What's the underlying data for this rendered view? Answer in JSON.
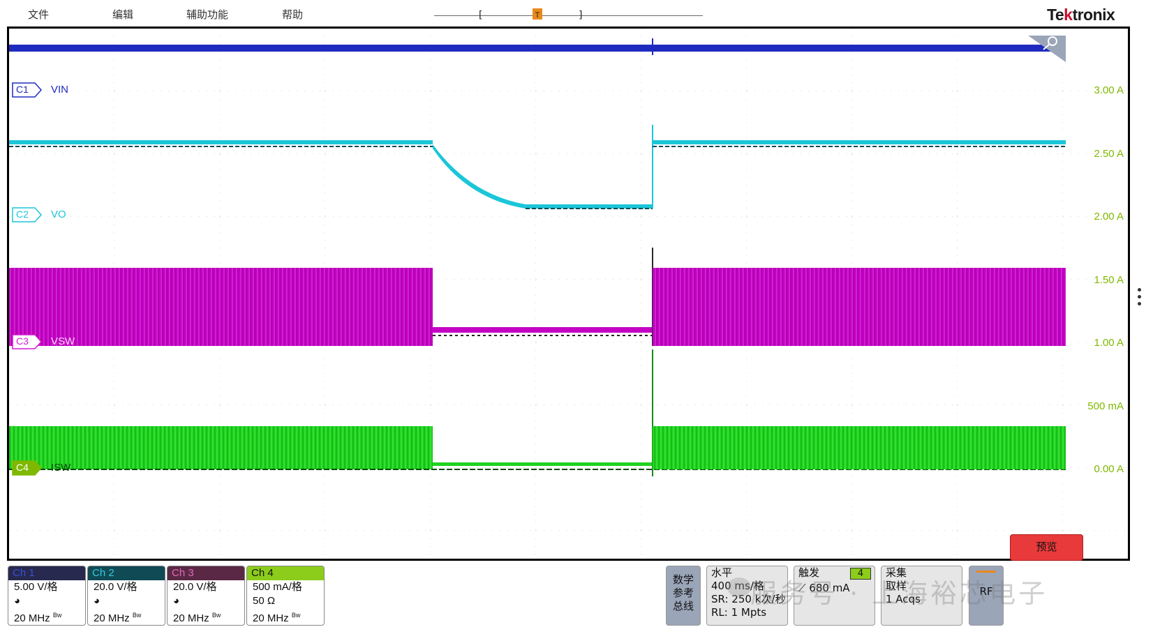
{
  "menu": [
    "文件",
    "编辑",
    "辅助功能",
    "帮助"
  ],
  "brand": {
    "prefix": "Te",
    "mark": "k",
    "suffix": "tronix"
  },
  "timeline": {
    "left_bracket": "[",
    "right_bracket": "]",
    "trigger_marker": "T"
  },
  "channels_on_screen": [
    {
      "tag": "C1",
      "name": "VIN",
      "color": "#1f2bbf"
    },
    {
      "tag": "C2",
      "name": "VO",
      "color": "#1bc6d8"
    },
    {
      "tag": "C3",
      "name": "VSW",
      "color": "#d21cd2"
    },
    {
      "tag": "C4",
      "name": "ISW",
      "color": "#2fd92f"
    }
  ],
  "axis_labels": [
    "3.00 A",
    "2.50 A",
    "2.00 A",
    "1.50 A",
    "1.00 A",
    "500 mA",
    "0.00 A"
  ],
  "channel_panels": [
    {
      "title": "Ch 1",
      "scale": "5.00 V/格",
      "bw": "20 MHz",
      "hdr_bg": "#27294f",
      "hdr_fg": "#3a4fd8"
    },
    {
      "title": "Ch 2",
      "scale": "20.0 V/格",
      "bw": "20 MHz",
      "hdr_bg": "#0f4a55",
      "hdr_fg": "#39c8dd"
    },
    {
      "title": "Ch 3",
      "scale": "20.0 V/格",
      "bw": "20 MHz",
      "hdr_bg": "#5a2844",
      "hdr_fg": "#e06ab8"
    },
    {
      "title": "Ch 4",
      "scale": "500 mA/格",
      "impedance": "50 Ω",
      "bw": "20 MHz",
      "hdr_bg": "#8ccc1a",
      "hdr_fg": "#111111"
    }
  ],
  "bw_suffix": "Bw",
  "digital_ref_bus": [
    "数学",
    "参考",
    "总线"
  ],
  "horizontal": {
    "title": "水平",
    "scale": "400 ms/格",
    "sr": "SR: 250 k次/秒",
    "rl": "RL: 1 Mpts"
  },
  "trigger": {
    "title": "触发",
    "channel": "4",
    "level": "680 mA"
  },
  "acquisition": {
    "title": "采集",
    "mode": "取样",
    "acqs": "1 Acqs"
  },
  "rf_label": "RF",
  "preview_label": "预览",
  "watermark": "服务号 · 上海裕芯电子"
}
